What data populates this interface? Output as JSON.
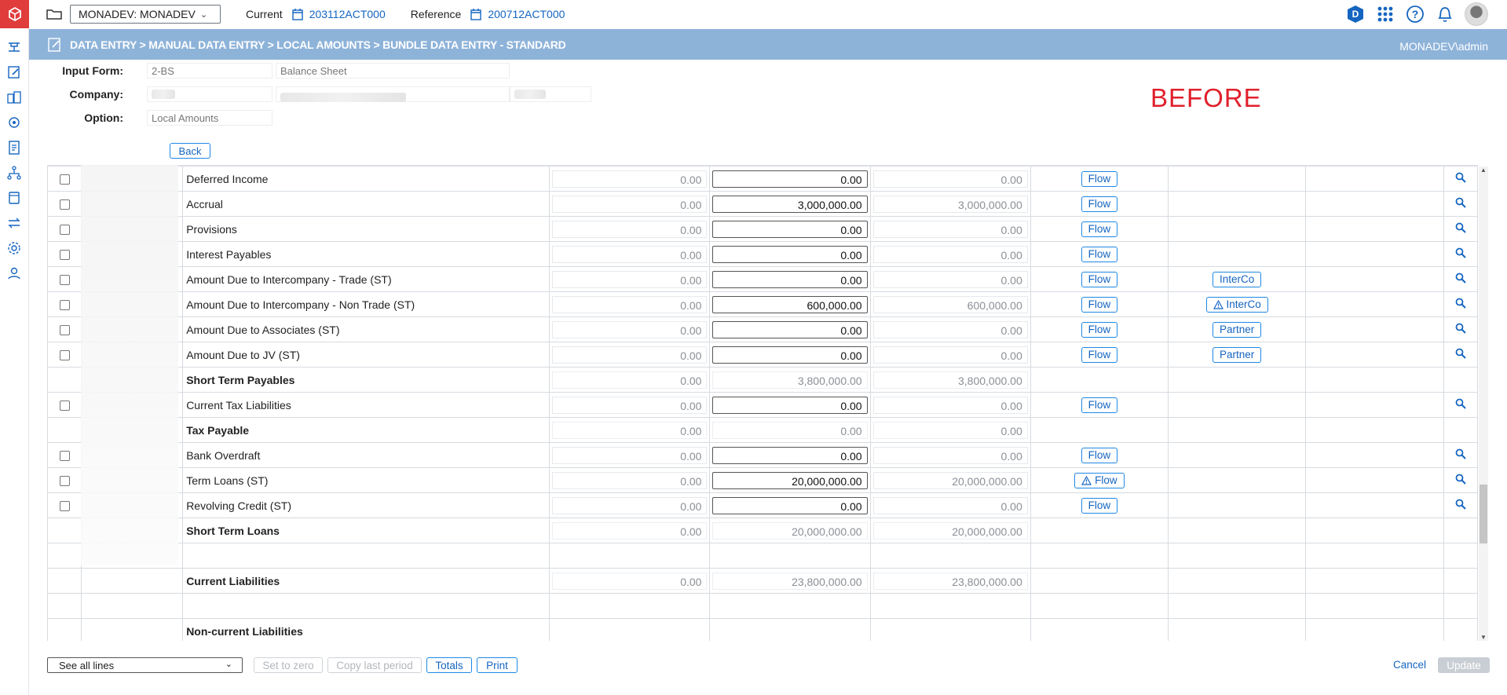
{
  "topbar": {
    "database": "MONADEV: MONADEV",
    "current_label": "Current",
    "current_period": "203112ACT000",
    "reference_label": "Reference",
    "reference_period": "200712ACT000"
  },
  "breadcrumb": "DATA ENTRY > MANUAL DATA ENTRY > LOCAL AMOUNTS > BUNDLE DATA ENTRY - STANDARD",
  "user": "MONADEV\\admin",
  "form": {
    "input_form_label": "Input Form:",
    "input_form_code": "2-BS",
    "input_form_name": "Balance Sheet",
    "company_label": "Company:",
    "option_label": "Option:",
    "option_value": "Local Amounts",
    "back_label": "Back"
  },
  "annotation": "BEFORE",
  "rows": [
    {
      "type": "entry",
      "desc": "Deferred Income",
      "ref": "0.00",
      "cur": "0.00",
      "diff": "0.00",
      "flow": "Flow",
      "flow_warn": false,
      "extra": "",
      "extra_warn": false
    },
    {
      "type": "entry",
      "desc": "Accrual",
      "ref": "0.00",
      "cur": "3,000,000.00",
      "diff": "3,000,000.00",
      "flow": "Flow",
      "flow_warn": false,
      "extra": "",
      "extra_warn": false
    },
    {
      "type": "entry",
      "desc": "Provisions",
      "ref": "0.00",
      "cur": "0.00",
      "diff": "0.00",
      "flow": "Flow",
      "flow_warn": false,
      "extra": "",
      "extra_warn": false
    },
    {
      "type": "entry",
      "desc": "Interest Payables",
      "ref": "0.00",
      "cur": "0.00",
      "diff": "0.00",
      "flow": "Flow",
      "flow_warn": false,
      "extra": "",
      "extra_warn": false
    },
    {
      "type": "entry",
      "desc": "Amount Due to Intercompany - Trade (ST)",
      "ref": "0.00",
      "cur": "0.00",
      "diff": "0.00",
      "flow": "Flow",
      "flow_warn": false,
      "extra": "InterCo",
      "extra_warn": false
    },
    {
      "type": "entry",
      "desc": "Amount Due to Intercompany - Non Trade (ST)",
      "ref": "0.00",
      "cur": "600,000.00",
      "diff": "600,000.00",
      "flow": "Flow",
      "flow_warn": false,
      "extra": "InterCo",
      "extra_warn": true
    },
    {
      "type": "entry",
      "desc": "Amount Due to Associates (ST)",
      "ref": "0.00",
      "cur": "0.00",
      "diff": "0.00",
      "flow": "Flow",
      "flow_warn": false,
      "extra": "Partner",
      "extra_warn": false
    },
    {
      "type": "entry",
      "desc": "Amount Due to JV (ST)",
      "ref": "0.00",
      "cur": "0.00",
      "diff": "0.00",
      "flow": "Flow",
      "flow_warn": false,
      "extra": "Partner",
      "extra_warn": false
    },
    {
      "type": "total",
      "desc": "Short Term Payables",
      "ref": "0.00",
      "cur": "3,800,000.00",
      "diff": "3,800,000.00"
    },
    {
      "type": "entry",
      "desc": "Current Tax Liabilities",
      "ref": "0.00",
      "cur": "0.00",
      "diff": "0.00",
      "flow": "Flow",
      "flow_warn": false,
      "extra": "",
      "extra_warn": false
    },
    {
      "type": "total",
      "desc": "Tax Payable",
      "ref": "0.00",
      "cur": "0.00",
      "diff": "0.00"
    },
    {
      "type": "entry",
      "desc": "Bank Overdraft",
      "ref": "0.00",
      "cur": "0.00",
      "diff": "0.00",
      "flow": "Flow",
      "flow_warn": false,
      "extra": "",
      "extra_warn": false
    },
    {
      "type": "entry",
      "desc": "Term Loans (ST)",
      "ref": "0.00",
      "cur": "20,000,000.00",
      "diff": "20,000,000.00",
      "flow": "Flow",
      "flow_warn": true,
      "extra": "",
      "extra_warn": false
    },
    {
      "type": "entry",
      "desc": "Revolving Credit (ST)",
      "ref": "0.00",
      "cur": "0.00",
      "diff": "0.00",
      "flow": "Flow",
      "flow_warn": false,
      "extra": "",
      "extra_warn": false
    },
    {
      "type": "total",
      "desc": "Short Term Loans",
      "ref": "0.00",
      "cur": "20,000,000.00",
      "diff": "20,000,000.00"
    },
    {
      "type": "empty"
    },
    {
      "type": "total",
      "desc": "Current Liabilities",
      "ref": "0.00",
      "cur": "23,800,000.00",
      "diff": "23,800,000.00"
    },
    {
      "type": "empty"
    },
    {
      "type": "header",
      "desc": "Non-current Liabilities"
    }
  ],
  "bottom": {
    "lines_filter": "See all lines",
    "set_to_zero": "Set to zero",
    "copy_last_period": "Copy last period",
    "totals": "Totals",
    "print": "Print",
    "cancel": "Cancel",
    "update": "Update"
  },
  "colors": {
    "accent": "#1e88e5",
    "header_bar": "#8eb3d9",
    "brand_red": "#e03c3c",
    "annotation_red": "#e0202c"
  }
}
